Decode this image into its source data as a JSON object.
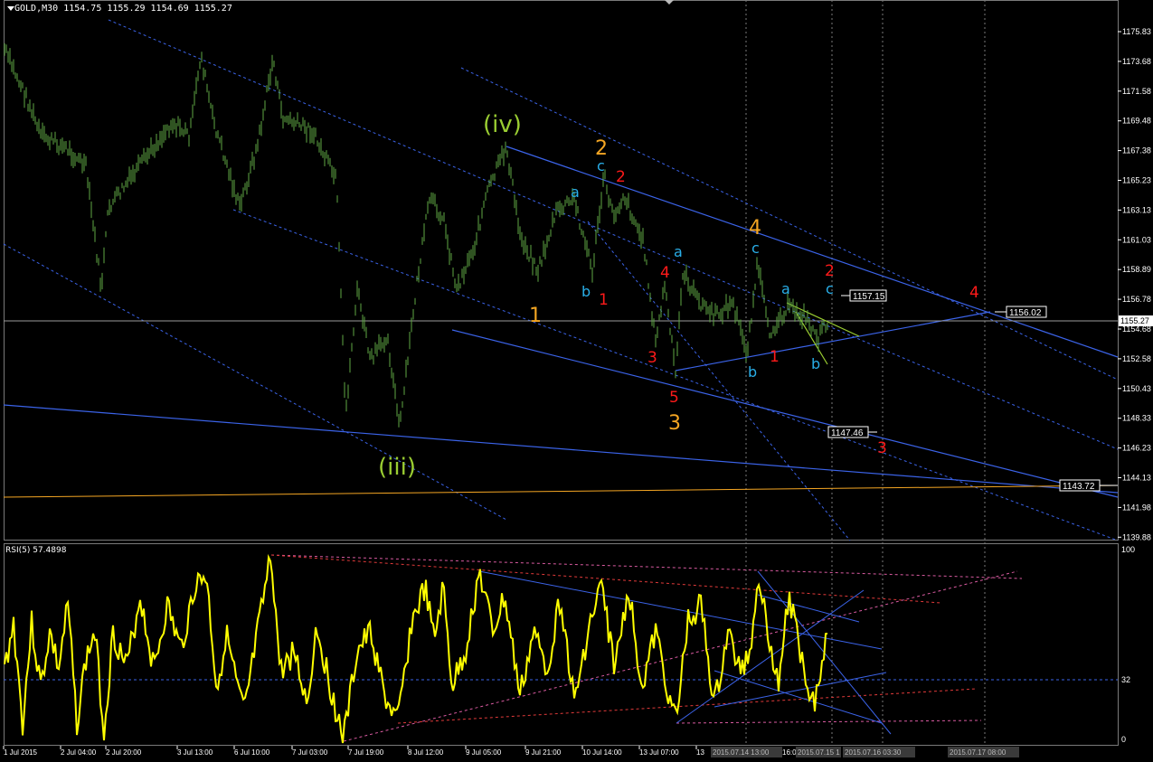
{
  "window": {
    "symbol_label": "GOLD,M30",
    "ohlc": "1154.75 1155.29 1154.69 1155.27"
  },
  "price_axis": {
    "ticks": [
      "1175.83",
      "1173.68",
      "1171.58",
      "1169.48",
      "1167.38",
      "1165.23",
      "1163.13",
      "1161.03",
      "1158.89",
      "1156.78",
      "1154.68",
      "1152.58",
      "1150.43",
      "1148.33",
      "1146.23",
      "1144.13",
      "1141.98",
      "1139.88"
    ],
    "current_price": "1155.27"
  },
  "rsi": {
    "label": "RSI(5) 57.4898",
    "levels": [
      "100",
      "32",
      "0"
    ]
  },
  "time_axis": {
    "ticks": [
      "1 Jul 2015",
      "2 Jul 04:00",
      "2 Jul 20:00",
      "3 Jul 13:00",
      "6 Jul 10:00",
      "7 Jul 03:00",
      "7 Jul 19:00",
      "8 Jul 12:00",
      "9 Jul 05:00",
      "9 Jul 21:00",
      "10 Jul 14:00",
      "13 Jul 07:00",
      "13"
    ],
    "highlighted": [
      "2015.07.14 13:00",
      "16:0",
      "2015.07.15 1",
      "2015.07.16 03:30",
      "2015.07.17 08:00"
    ]
  },
  "price_tags": {
    "t1": "1157.15",
    "t2": "1156.02",
    "t3": "1147.46",
    "t4": "1143.72"
  },
  "wave_labels": {
    "iv": "(iv)",
    "iii": "(iii)",
    "o2": "2",
    "o1": "1",
    "o3": "3",
    "o4": "4",
    "c1": "c",
    "a1": "a",
    "b1": "b",
    "a2": "a",
    "c2": "c",
    "a3": "a",
    "b2": "b",
    "b3": "b",
    "c3": "c",
    "r2a": "2",
    "r1a": "1",
    "r4a": "4",
    "r3a": "3",
    "r5": "5",
    "r1b": "1",
    "r2b": "2",
    "r3b": "3",
    "r4b": "4"
  },
  "colors": {
    "background": "#000000",
    "candles": "#5fa845",
    "wave_green": "#9acd32",
    "wave_orange": "#f5a623",
    "wave_red": "#ff1a1a",
    "wave_cyan": "#29aee8",
    "trendline": "#3b63e8",
    "rsi_line": "#ffff00",
    "grid_text": "#ffffff"
  }
}
